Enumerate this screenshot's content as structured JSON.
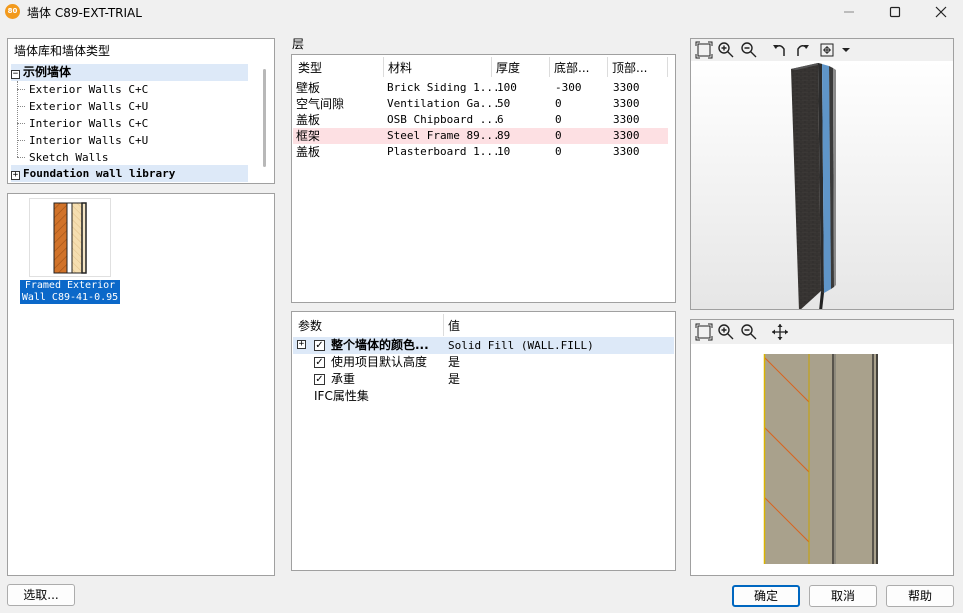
{
  "window": {
    "title": "墙体 C89-EXT-TRIAL",
    "app_icon_text": "80"
  },
  "tree": {
    "root": "墙体库和墙体类型",
    "group": {
      "expander": "−",
      "label": "示例墙体"
    },
    "items": [
      "Exterior Walls C+C",
      "Exterior Walls C+U",
      "Interior Walls C+C",
      "Interior Walls C+U",
      "Sketch Walls"
    ],
    "library": {
      "expander": "+",
      "label": "Foundation wall library"
    }
  },
  "preview": {
    "caption_line1": "Framed Exterior",
    "caption_line2": "Wall C89-41-0.95"
  },
  "layers": {
    "caption": "层",
    "headers": [
      "类型",
      "材料",
      "厚度",
      "底部...",
      "顶部..."
    ],
    "rows": [
      {
        "type": "壁板",
        "material": "Brick Siding 1...",
        "thickness": "100",
        "bottom": "-300",
        "top": "3300"
      },
      {
        "type": "空气间隙",
        "material": "Ventilation Ga...",
        "thickness": "50",
        "bottom": "0",
        "top": "3300"
      },
      {
        "type": "盖板",
        "material": "OSB Chipboard ...",
        "thickness": "6",
        "bottom": "0",
        "top": "3300"
      },
      {
        "type": "框架",
        "material": "Steel Frame 89...",
        "thickness": "89",
        "bottom": "0",
        "top": "3300"
      },
      {
        "type": "盖板",
        "material": "Plasterboard 1...",
        "thickness": "10",
        "bottom": "0",
        "top": "3300"
      }
    ],
    "highlight_color": "#fde0e3"
  },
  "params": {
    "headers": [
      "参数",
      "值"
    ],
    "rows": [
      {
        "expander": "+",
        "checkbox": "✓",
        "label": "整个墙体的颜色...",
        "value": "Solid Fill  (WALL.FILL)"
      },
      {
        "checkbox": "✓",
        "label": "使用项目默认高度",
        "value": "是"
      },
      {
        "checkbox": "✓",
        "label": "承重",
        "value": "是"
      },
      {
        "label": "IFC属性集",
        "value": ""
      }
    ]
  },
  "views": {
    "toolbar_3d": [
      "zoom-extents-icon",
      "zoom-in-icon",
      "zoom-out-icon",
      "rotate-left-icon",
      "rotate-right-icon",
      "view-mode-icon",
      "dropdown-arrow-icon"
    ],
    "toolbar_2d": [
      "zoom-extents-icon",
      "zoom-in-icon",
      "zoom-out-icon",
      "pan-icon"
    ]
  },
  "buttons": {
    "select": "选取...",
    "ok": "确定",
    "cancel": "取消",
    "help": "帮助"
  },
  "colors": {
    "selection": "#0b68c9",
    "ok_border": "#0067c0",
    "brick": "#d1732a",
    "steel": "#a9a18c"
  }
}
